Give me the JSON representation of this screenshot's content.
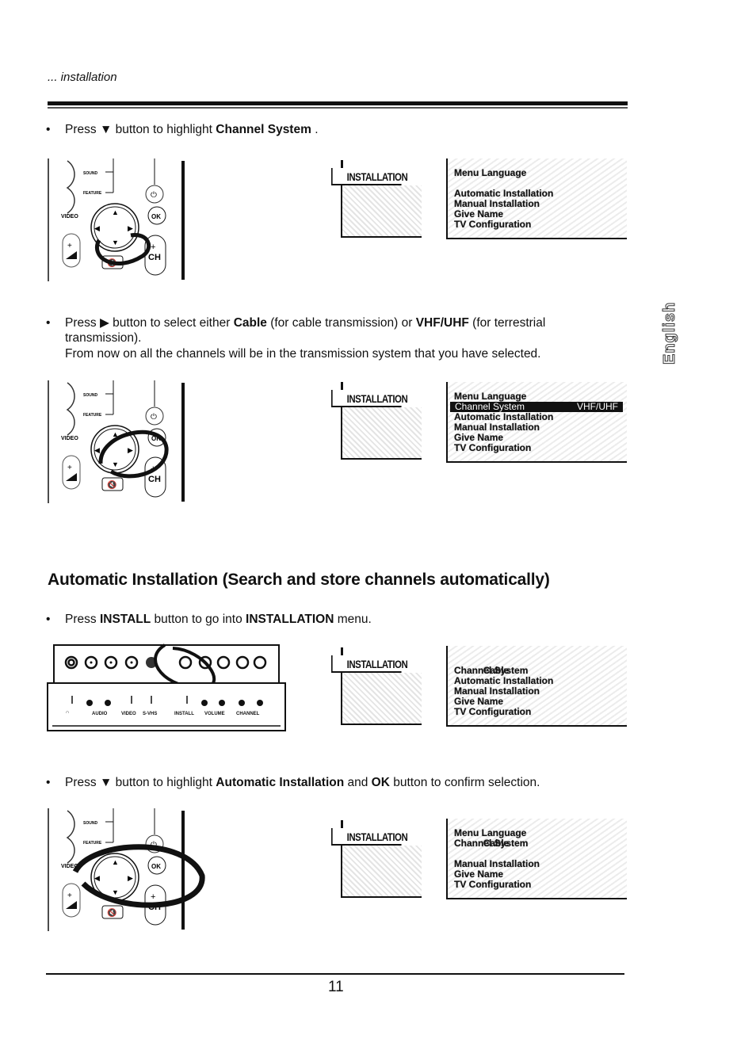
{
  "header": {
    "section_label": "... installation"
  },
  "side_tab": {
    "label": "English"
  },
  "steps": [
    {
      "id": "step-highlight-channel-system",
      "parts": [
        {
          "t": "Press ",
          "b": false
        },
        {
          "t": "▼",
          "b": false
        },
        {
          "t": " button to highlight ",
          "b": false
        },
        {
          "t": "Channel System",
          "b": true
        },
        {
          "t": " .",
          "b": false
        }
      ]
    },
    {
      "id": "step-select-cable-vhf",
      "parts": [
        {
          "t": "Press ",
          "b": false
        },
        {
          "t": "▶",
          "b": false
        },
        {
          "t": " button to select either ",
          "b": false
        },
        {
          "t": "Cable",
          "b": true
        },
        {
          "t": " (for cable transmission) or ",
          "b": false
        },
        {
          "t": "VHF/UHF",
          "b": true
        },
        {
          "t": " (for terrestrial transmission).",
          "b": false
        }
      ],
      "note": "From now on all the channels will be in the transmission system that you have selected."
    },
    {
      "id": "step-press-install",
      "parts": [
        {
          "t": "Press ",
          "b": false
        },
        {
          "t": "INSTALL",
          "b": true
        },
        {
          "t": " button to go into ",
          "b": false
        },
        {
          "t": "INSTALLATION",
          "b": true
        },
        {
          "t": " menu.",
          "b": false
        }
      ]
    },
    {
      "id": "step-highlight-auto-install",
      "parts": [
        {
          "t": "Press ",
          "b": false
        },
        {
          "t": "▼",
          "b": false
        },
        {
          "t": " button to highlight ",
          "b": false
        },
        {
          "t": "Automatic Installation",
          "b": true
        },
        {
          "t": " and ",
          "b": false
        },
        {
          "t": "OK",
          "b": true
        },
        {
          "t": " button to confirm selection.",
          "b": false
        }
      ]
    }
  ],
  "section": {
    "title": "Automatic Installation (Search and store channels automatically)"
  },
  "remote": {
    "labels": {
      "sound": "SOUND",
      "feature": "FEATURE",
      "video": "VIDEO",
      "ok": "OK",
      "ch": "CH"
    },
    "icons": [
      "power-icon",
      "arrow-up-icon",
      "arrow-down-icon",
      "arrow-left-icon",
      "arrow-right-icon",
      "volume-icon",
      "mute-icon"
    ]
  },
  "front_panel": {
    "labels": [
      "AUDIO",
      "VIDEO",
      "S-VHS",
      "INSTALL",
      "VOLUME",
      "CHANNEL"
    ],
    "sockets": [
      "headphone",
      "L",
      "R"
    ]
  },
  "osd": {
    "tab_label": "INSTALLATION",
    "menus": [
      {
        "rows": [
          {
            "label": "Menu Language",
            "value": "",
            "highlight": false
          },
          {
            "label": "",
            "value": "",
            "highlight": false
          },
          {
            "label": "Automatic Installation",
            "value": "",
            "highlight": false
          },
          {
            "label": "Manual Installation",
            "value": "",
            "highlight": false
          },
          {
            "label": "Give Name",
            "value": "",
            "highlight": false
          },
          {
            "label": "TV Configuration",
            "value": "",
            "highlight": false
          }
        ]
      },
      {
        "rows": [
          {
            "label": "Menu Language",
            "value": "",
            "highlight": false
          },
          {
            "label": "Channel System",
            "value": "VHF/UHF",
            "highlight": true
          },
          {
            "label": "Automatic Installation",
            "value": "",
            "highlight": false
          },
          {
            "label": "Manual Installation",
            "value": "",
            "highlight": false
          },
          {
            "label": "Give Name",
            "value": "",
            "highlight": false
          },
          {
            "label": "TV Configuration",
            "value": "",
            "highlight": false
          }
        ]
      },
      {
        "rows": [
          {
            "label": "",
            "value": "",
            "highlight": false
          },
          {
            "label": "Channel System",
            "value": "Cable",
            "highlight": false
          },
          {
            "label": "Automatic Installation",
            "value": "",
            "highlight": false
          },
          {
            "label": "Manual Installation",
            "value": "",
            "highlight": false
          },
          {
            "label": "Give Name",
            "value": "",
            "highlight": false
          },
          {
            "label": "TV Configuration",
            "value": "",
            "highlight": false
          }
        ]
      },
      {
        "rows": [
          {
            "label": "Menu Language",
            "value": "",
            "highlight": false
          },
          {
            "label": "Channel System",
            "value": "Cable",
            "highlight": false
          },
          {
            "label": "",
            "value": "",
            "highlight": false
          },
          {
            "label": "Manual Installation",
            "value": "",
            "highlight": false
          },
          {
            "label": "Give Name",
            "value": "",
            "highlight": false
          },
          {
            "label": "TV Configuration",
            "value": "",
            "highlight": false
          }
        ]
      }
    ]
  },
  "footer": {
    "page_number": "11"
  }
}
